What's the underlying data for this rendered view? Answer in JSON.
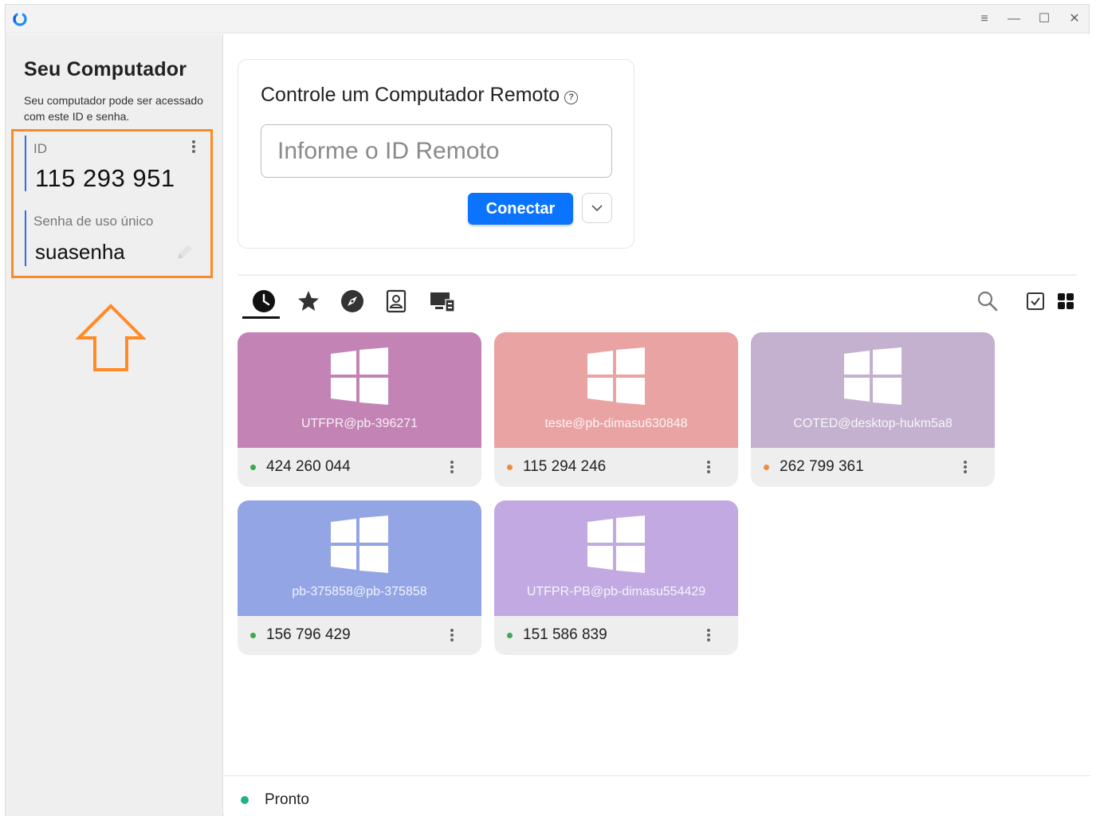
{
  "window": {
    "controls": [
      "≡",
      "—",
      "☐",
      "✕"
    ]
  },
  "sidebar": {
    "title": "Seu Computador",
    "description": "Seu computador pode ser acessado com este ID e senha.",
    "id_label": "ID",
    "id_value": "115 293 951",
    "password_label": "Senha de uso único",
    "password_value": "suasenha",
    "highlight_color": "#ff8a26"
  },
  "connect": {
    "title": "Controle um Computador Remoto",
    "help_glyph": "?",
    "input_placeholder": "Informe o ID Remoto",
    "connect_button": "Conectar",
    "accent": "#0a74ff"
  },
  "tabs": [
    {
      "icon": "clock-icon",
      "active": true
    },
    {
      "icon": "star-icon",
      "active": false
    },
    {
      "icon": "compass-icon",
      "active": false
    },
    {
      "icon": "address-book-icon",
      "active": false
    },
    {
      "icon": "lan-computer-icon",
      "active": false
    }
  ],
  "toolbar_icons": [
    "search-icon",
    "checkbox-icon",
    "grid-view-icon"
  ],
  "peers": [
    {
      "name": "UTFPR@pb-396271",
      "id": "424 260 044",
      "color": "#c384b5",
      "status": "#3fa94e"
    },
    {
      "name": "teste@pb-dimasu630848",
      "id": "115 294 246",
      "color": "#eaa3a3",
      "status": "#f08a3c"
    },
    {
      "name": "COTED@desktop-hukm5a8",
      "id": "262 799 361",
      "color": "#c4b1cf",
      "status": "#f08a3c"
    },
    {
      "name": "pb-375858@pb-375858",
      "id": "156 796 429",
      "color": "#93a5e4",
      "status": "#3fa94e"
    },
    {
      "name": "UTFPR-PB@pb-dimasu554429",
      "id": "151 586 839",
      "color": "#c2a9e2",
      "status": "#3fa94e"
    }
  ],
  "status": {
    "text": "Pronto",
    "color": "#1fb28a"
  }
}
